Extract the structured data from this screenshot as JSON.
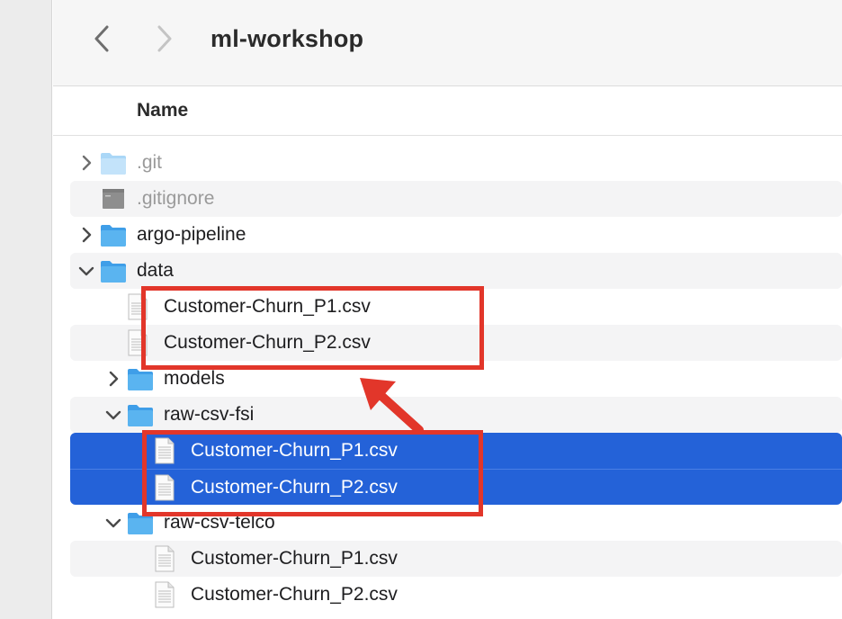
{
  "toolbar": {
    "title": "ml-workshop",
    "back_icon": "chevron-left-icon",
    "forward_icon": "chevron-right-icon"
  },
  "columns": {
    "name": "Name"
  },
  "files": [
    {
      "name": ".git",
      "kind": "folder",
      "expanded": false
    },
    {
      "name": ".gitignore",
      "kind": "executable"
    },
    {
      "name": "argo-pipeline",
      "kind": "folder",
      "expanded": false
    },
    {
      "name": "data",
      "kind": "folder",
      "expanded": true
    },
    {
      "name": "Customer-Churn_P1.csv",
      "kind": "csv"
    },
    {
      "name": "Customer-Churn_P2.csv",
      "kind": "csv"
    },
    {
      "name": "models",
      "kind": "folder",
      "expanded": false
    },
    {
      "name": "raw-csv-fsi",
      "kind": "folder",
      "expanded": true
    },
    {
      "name": "Customer-Churn_P1.csv",
      "kind": "csv",
      "selected": true
    },
    {
      "name": "Customer-Churn_P2.csv",
      "kind": "csv",
      "selected": true
    },
    {
      "name": "raw-csv-telco",
      "kind": "folder",
      "expanded": true
    },
    {
      "name": "Customer-Churn_P1.csv",
      "kind": "csv"
    },
    {
      "name": "Customer-Churn_P2.csv",
      "kind": "csv"
    }
  ],
  "colors": {
    "selection": "#2462d8",
    "annotation": "#e2362a",
    "folder": "#5ab4f0"
  }
}
